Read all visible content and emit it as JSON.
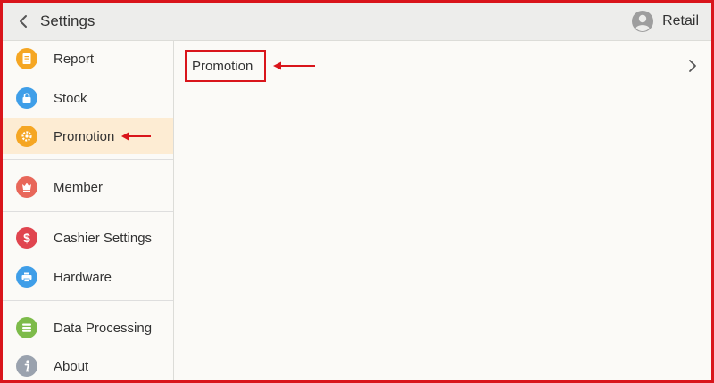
{
  "header": {
    "title": "Settings",
    "user_name": "Retail"
  },
  "sidebar": {
    "items": [
      {
        "label": "Report",
        "icon": "report-icon",
        "color": "#f5a623"
      },
      {
        "label": "Stock",
        "icon": "lock-icon",
        "color": "#3f9ee8"
      },
      {
        "label": "Promotion",
        "icon": "gear-icon",
        "color": "#f5a623",
        "active": true
      },
      {
        "label": "Member",
        "icon": "member-icon",
        "color": "#e8675a"
      },
      {
        "label": "Cashier Settings",
        "icon": "dollar-icon",
        "color": "#e0454f"
      },
      {
        "label": "Hardware",
        "icon": "printer-icon",
        "color": "#3f9ee8"
      },
      {
        "label": "Data Processing",
        "icon": "layers-icon",
        "color": "#7dbb4a"
      },
      {
        "label": "About",
        "icon": "info-icon",
        "color": "#9aa2ae"
      }
    ]
  },
  "main": {
    "rows": [
      {
        "label": "Promotion"
      }
    ]
  },
  "colors": {
    "annotation_red": "#d9151b",
    "active_bg": "#fdecd3"
  }
}
